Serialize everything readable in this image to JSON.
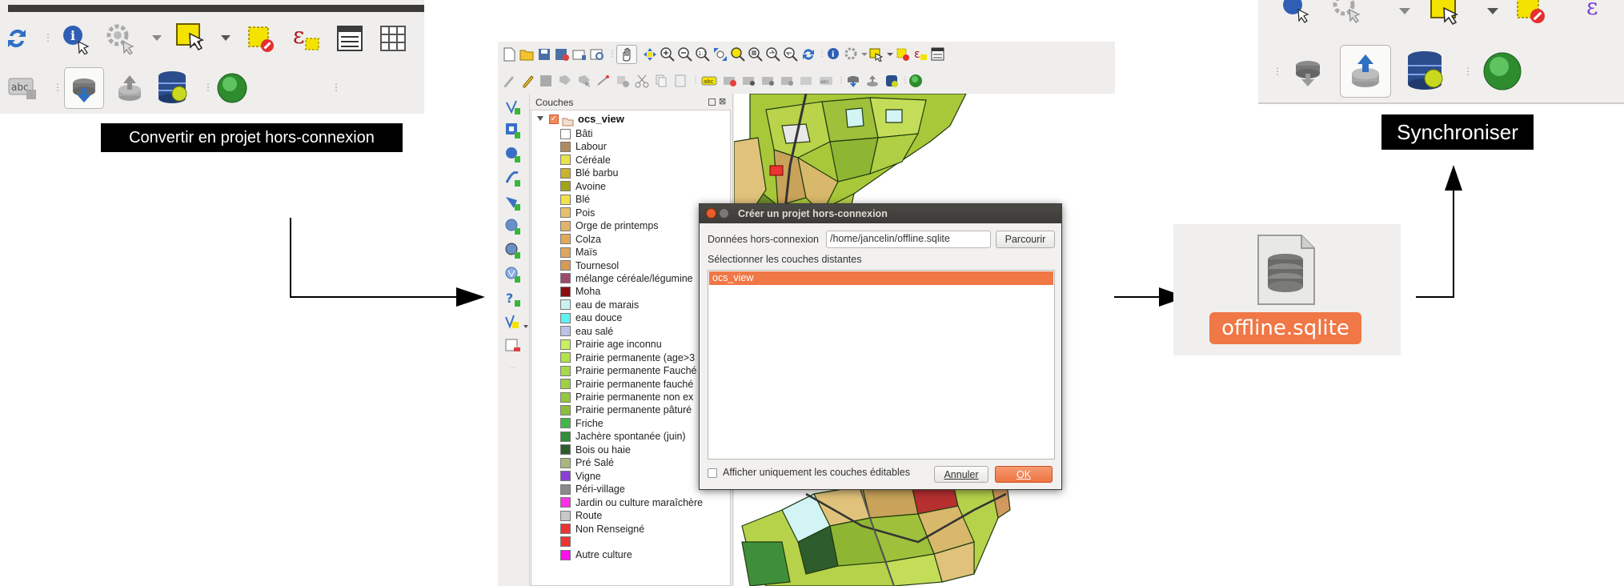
{
  "panel1": {
    "tooltip": "Convertir en projet hors-connexion",
    "colors": {
      "tooltip_bg": "#000000",
      "tooltip_fg": "#ffffff"
    },
    "icons": [
      "refresh-icon",
      "identify-icon",
      "gear-zoom-icon",
      "select-features-icon",
      "deselect-icon",
      "expression-select-icon",
      "attribute-table-icon",
      "field-calculator-icon",
      "label-icon",
      "convert-offline-icon",
      "synchronize-icon",
      "spatialite-db-icon",
      "globe-plugin-icon"
    ]
  },
  "panel2": {
    "tooltip": "Synchroniser",
    "icons": [
      "select-features-icon",
      "deselect-icon",
      "convert-offline-icon",
      "synchronize-icon",
      "spatialite-db-icon",
      "globe-plugin-icon"
    ]
  },
  "qgis": {
    "layers_title": "Couches",
    "group_name": "ocs_view",
    "layers": [
      {
        "label": "Bâti",
        "color": "#ffffff"
      },
      {
        "label": "Labour",
        "color": "#b38a5e"
      },
      {
        "label": "Céréale",
        "color": "#e9e24a"
      },
      {
        "label": "Blé barbu",
        "color": "#c9b22e"
      },
      {
        "label": "Avoine",
        "color": "#a3a31a"
      },
      {
        "label": "Blé",
        "color": "#f0e24a"
      },
      {
        "label": "Pois",
        "color": "#e7c069"
      },
      {
        "label": "Orge de printemps",
        "color": "#e0b46a"
      },
      {
        "label": "Colza",
        "color": "#e0a85a"
      },
      {
        "label": "Maïs",
        "color": "#dfa85f"
      },
      {
        "label": "Tournesol",
        "color": "#d79b58"
      },
      {
        "label": "mélange céréale/légumine",
        "color": "#9e4a6b"
      },
      {
        "label": "Moha",
        "color": "#8b0f0f"
      },
      {
        "label": "eau de marais",
        "color": "#c9f2f2"
      },
      {
        "label": "eau douce",
        "color": "#60f2f2"
      },
      {
        "label": "eau salé",
        "color": "#b9c3e9"
      },
      {
        "label": "Prairie age inconnu",
        "color": "#c8f060"
      },
      {
        "label": "Prairie permanente (age>3",
        "color": "#b2e34a"
      },
      {
        "label": "Prairie permanente Fauché",
        "color": "#a8d94b"
      },
      {
        "label": "Prairie permanente fauché",
        "color": "#9fd045"
      },
      {
        "label": "Prairie permanente non ex",
        "color": "#96c63e"
      },
      {
        "label": "Prairie permanente pâturé",
        "color": "#8dbd38"
      },
      {
        "label": "Friche",
        "color": "#3fb84a"
      },
      {
        "label": "Jachère spontanée (juin)",
        "color": "#2f8f3a"
      },
      {
        "label": "Bois ou haie",
        "color": "#2d5c2d"
      },
      {
        "label": "Pré Salé",
        "color": "#a8b87a"
      },
      {
        "label": "Vigne",
        "color": "#8a3fd6"
      },
      {
        "label": "Péri-village",
        "color": "#8a8a8a"
      },
      {
        "label": "Jardin ou culture maraîchère",
        "color": "#ff2fe6"
      },
      {
        "label": "Route",
        "color": "#c8c8c8"
      },
      {
        "label": "Non Renseigné",
        "color": "#ee3333"
      },
      {
        "label": "",
        "color": "#ee3333"
      },
      {
        "label": "Autre culture",
        "color": "#ff10ee"
      }
    ]
  },
  "dialog": {
    "title": "Créer un projet hors-connexion",
    "data_label": "Données hors-connexion",
    "data_value": "/home/jancelin/offline.sqlite",
    "browse_label": "Parcourir",
    "select_label": "Sélectionner les couches distantes",
    "list_items": [
      "ocs_view"
    ],
    "checkbox_label": "Afficher uniquement les couches éditables",
    "cancel_label": "Annuler",
    "ok_label": "OK",
    "colors": {
      "selection": "#f07746",
      "ok_button": "#f07746"
    }
  },
  "file": {
    "name": "offline.sqlite",
    "icon": "sqlite-file-icon",
    "colors": {
      "label_bg": "#f07746"
    }
  }
}
